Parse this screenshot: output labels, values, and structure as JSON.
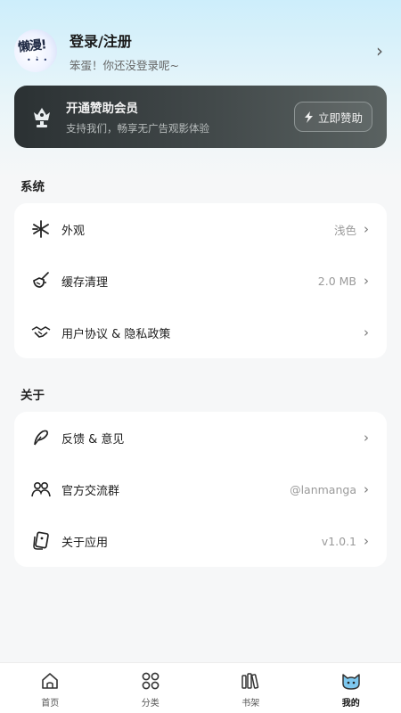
{
  "profile": {
    "avatar_text": "懒漫!",
    "title": "登录/注册",
    "subtitle": "笨蛋！你还没登录呢~"
  },
  "vip": {
    "title": "开通赞助会员",
    "subtitle": "支持我们，畅享无广告观影体验",
    "button": "立即赞助"
  },
  "sections": {
    "system": {
      "label": "系统",
      "items": [
        {
          "label": "外观",
          "value": "浅色",
          "icon": "appearance-icon"
        },
        {
          "label": "缓存清理",
          "value": "2.0 MB",
          "icon": "broom-icon"
        },
        {
          "label": "用户协议 & 隐私政策",
          "value": "",
          "icon": "handshake-icon"
        }
      ]
    },
    "about": {
      "label": "关于",
      "items": [
        {
          "label": "反馈 & 意见",
          "value": "",
          "icon": "feather-icon"
        },
        {
          "label": "官方交流群",
          "value": "@lanmanga",
          "icon": "group-icon"
        },
        {
          "label": "关于应用",
          "value": "v1.0.1",
          "icon": "app-info-icon"
        }
      ]
    }
  },
  "nav": {
    "items": [
      {
        "label": "首页",
        "icon": "home-icon"
      },
      {
        "label": "分类",
        "icon": "category-icon"
      },
      {
        "label": "书架",
        "icon": "bookshelf-icon"
      },
      {
        "label": "我的",
        "icon": "cat-profile-icon"
      }
    ],
    "active_index": 3
  },
  "colors": {
    "vip_bg": "#2b3133",
    "accent_sky": "#cdeefb",
    "active_nav_icon": "#7ec8ef"
  }
}
